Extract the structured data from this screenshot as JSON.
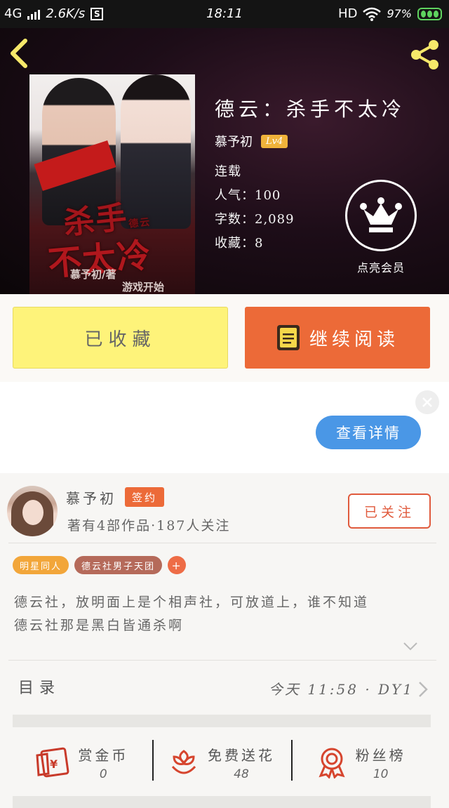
{
  "status_bar": {
    "network": "4G",
    "speed": "2.6K/s",
    "s_icon": "S",
    "time": "18:11",
    "hd": "HD",
    "battery": "97%"
  },
  "book": {
    "title": "德云：杀手不太冷",
    "author": "慕予初",
    "level": "Lv4",
    "status": "连载",
    "popularity": "人气：100",
    "word_count": "字数：2,089",
    "favorites": "收藏：8",
    "member_label": "点亮会员",
    "cover": {
      "title_line1": "杀手",
      "title_small": "德云",
      "title_line2": "不太冷",
      "author_credit": "慕予初/著",
      "game_start": "游戏开始"
    }
  },
  "actions": {
    "collected_label": "已收藏",
    "continue_label": "继续阅读"
  },
  "ad": {
    "details_label": "查看详情"
  },
  "author": {
    "name": "慕予初",
    "sign_badge": "签约",
    "stats": "著有4部作品·187人关注",
    "follow_label": "已关注"
  },
  "tags": [
    "明星同人",
    "德云社男子天团",
    "+"
  ],
  "description": {
    "line1": "德云社，放明面上是个相声社，可放道上，谁不知道",
    "line2": "德云社那是黑白皆通杀啊"
  },
  "toc": {
    "label": "目录",
    "update": "今天 11:58 · DY1"
  },
  "stats_row": [
    {
      "label": "赏金币",
      "value": "0",
      "icon": "red-envelope-icon"
    },
    {
      "label": "免费送花",
      "value": "48",
      "icon": "flower-icon"
    },
    {
      "label": "粉丝榜",
      "value": "10",
      "icon": "ribbon-medal-icon"
    }
  ],
  "colors": {
    "accent_orange": "#ec6a38",
    "collected_yellow": "#fef37a",
    "ad_blue": "#4a97e6",
    "header_dark": "#1d0d18"
  }
}
